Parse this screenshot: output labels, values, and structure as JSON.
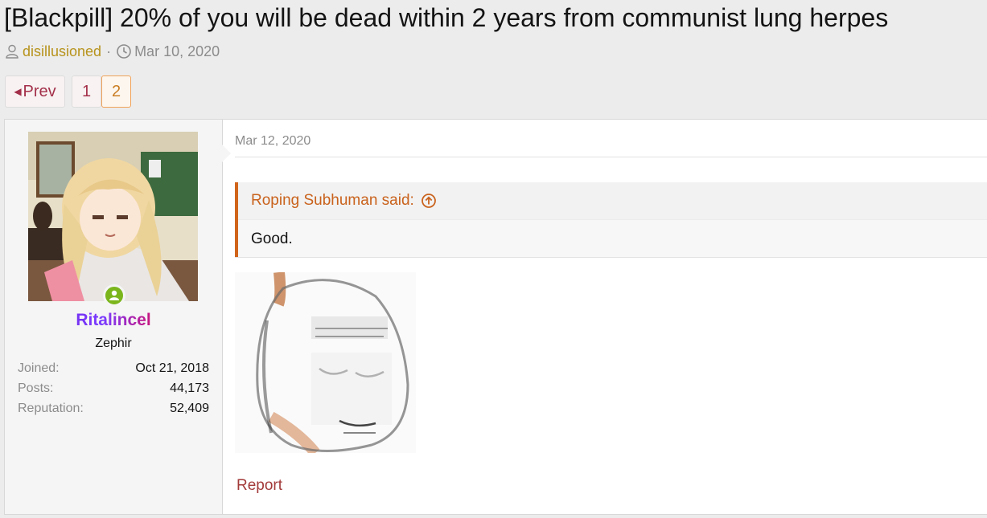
{
  "thread": {
    "title": "[Blackpill] 20% of you will be dead within 2 years from communist lung herpes",
    "author": "disillusioned",
    "separator": "·",
    "date": "Mar 10, 2020"
  },
  "pagination": {
    "prev_label": "Prev",
    "pages": [
      "1",
      "2"
    ],
    "current_page": "2"
  },
  "post": {
    "user": {
      "name": "Ritalincel",
      "title": "Zephir",
      "online": true,
      "stats": [
        {
          "label": "Joined:",
          "value": "Oct 21, 2018"
        },
        {
          "label": "Posts:",
          "value": "44,173"
        },
        {
          "label": "Reputation:",
          "value": "52,409"
        }
      ]
    },
    "date": "Mar 12, 2020",
    "quote": {
      "header": "Roping Subhuman said:",
      "body": "Good."
    },
    "report_label": "Report"
  },
  "icons": {
    "author": "user-icon",
    "date": "clock-icon",
    "quote_jump": "arrow-up-circle-icon"
  },
  "colors": {
    "link": "#a3304a",
    "author": "#b7931c",
    "quote_accent": "#d0641b",
    "online": "#7bb51c",
    "page_active": "#f0a35a"
  }
}
